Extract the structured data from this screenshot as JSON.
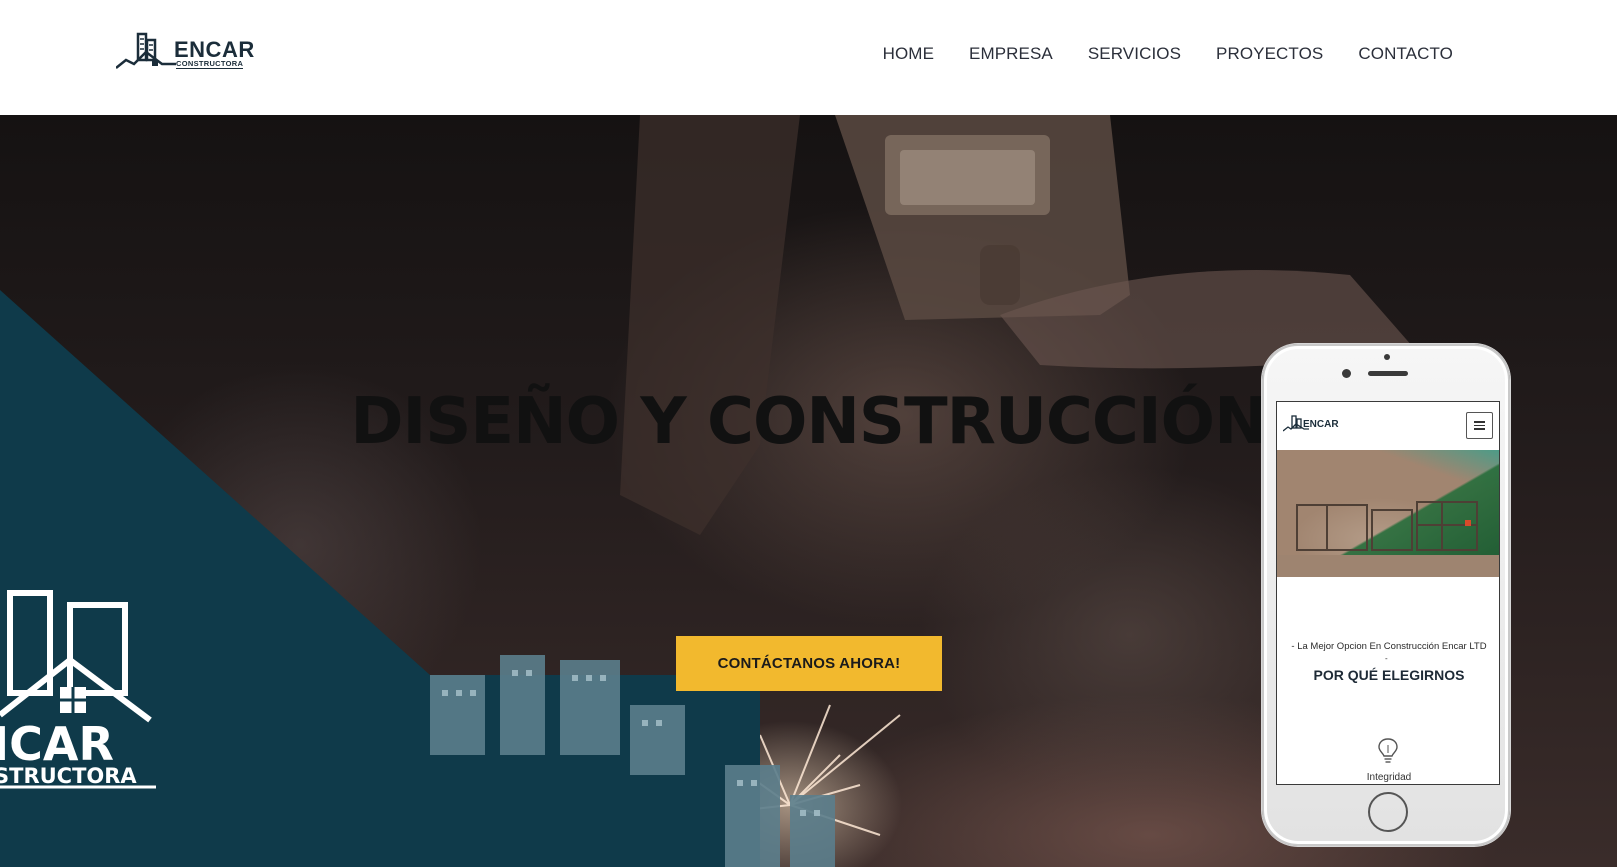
{
  "brand": {
    "name": "ENCAR",
    "subtitle": "CONSTRUCTORA",
    "watermark_name": "ICAR",
    "watermark_subtitle": "STRUCTORA"
  },
  "nav": {
    "items": [
      {
        "label": "HOME"
      },
      {
        "label": "EMPRESA"
      },
      {
        "label": "SERVICIOS"
      },
      {
        "label": "PROYECTOS"
      },
      {
        "label": "CONTACTO"
      }
    ]
  },
  "hero": {
    "title": "DISEÑO Y CONSTRUCCIÓN",
    "cta_label": "CONTÁCTANOS AHORA!"
  },
  "phone": {
    "logo_text": "ENCAR",
    "tagline": "- La Mejor Opcion En Construcción Encar LTD",
    "tagline_dash": "-",
    "heading": "POR QUÉ ELEGIRNOS",
    "feature_label": "Integridad",
    "feature_icon": "lightbulb-icon"
  },
  "colors": {
    "teal_panel": "#0f3a4a",
    "cta_yellow": "#f2b92e",
    "nav_text": "#2b2f3a",
    "title_text": "#111111"
  }
}
